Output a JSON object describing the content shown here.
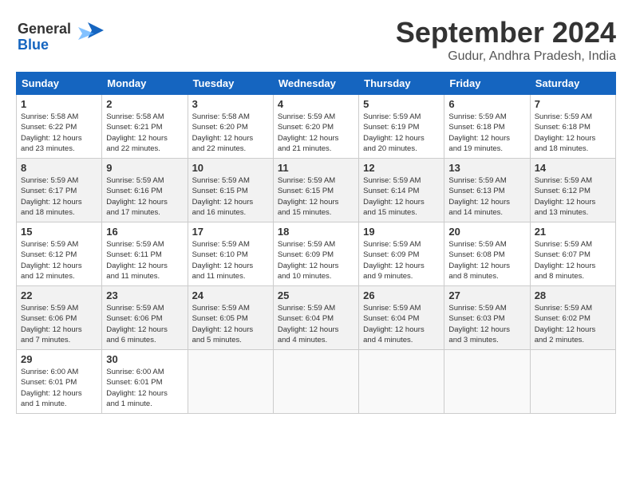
{
  "logo": {
    "line1": "General",
    "line2": "Blue"
  },
  "title": "September 2024",
  "location": "Gudur, Andhra Pradesh, India",
  "days_of_week": [
    "Sunday",
    "Monday",
    "Tuesday",
    "Wednesday",
    "Thursday",
    "Friday",
    "Saturday"
  ],
  "weeks": [
    [
      {
        "day": 1,
        "sunrise": "5:58 AM",
        "sunset": "6:22 PM",
        "daylight": "12 hours and 23 minutes."
      },
      {
        "day": 2,
        "sunrise": "5:58 AM",
        "sunset": "6:21 PM",
        "daylight": "12 hours and 22 minutes."
      },
      {
        "day": 3,
        "sunrise": "5:58 AM",
        "sunset": "6:20 PM",
        "daylight": "12 hours and 22 minutes."
      },
      {
        "day": 4,
        "sunrise": "5:59 AM",
        "sunset": "6:20 PM",
        "daylight": "12 hours and 21 minutes."
      },
      {
        "day": 5,
        "sunrise": "5:59 AM",
        "sunset": "6:19 PM",
        "daylight": "12 hours and 20 minutes."
      },
      {
        "day": 6,
        "sunrise": "5:59 AM",
        "sunset": "6:18 PM",
        "daylight": "12 hours and 19 minutes."
      },
      {
        "day": 7,
        "sunrise": "5:59 AM",
        "sunset": "6:18 PM",
        "daylight": "12 hours and 18 minutes."
      }
    ],
    [
      {
        "day": 8,
        "sunrise": "5:59 AM",
        "sunset": "6:17 PM",
        "daylight": "12 hours and 18 minutes."
      },
      {
        "day": 9,
        "sunrise": "5:59 AM",
        "sunset": "6:16 PM",
        "daylight": "12 hours and 17 minutes."
      },
      {
        "day": 10,
        "sunrise": "5:59 AM",
        "sunset": "6:15 PM",
        "daylight": "12 hours and 16 minutes."
      },
      {
        "day": 11,
        "sunrise": "5:59 AM",
        "sunset": "6:15 PM",
        "daylight": "12 hours and 15 minutes."
      },
      {
        "day": 12,
        "sunrise": "5:59 AM",
        "sunset": "6:14 PM",
        "daylight": "12 hours and 15 minutes."
      },
      {
        "day": 13,
        "sunrise": "5:59 AM",
        "sunset": "6:13 PM",
        "daylight": "12 hours and 14 minutes."
      },
      {
        "day": 14,
        "sunrise": "5:59 AM",
        "sunset": "6:12 PM",
        "daylight": "12 hours and 13 minutes."
      }
    ],
    [
      {
        "day": 15,
        "sunrise": "5:59 AM",
        "sunset": "6:12 PM",
        "daylight": "12 hours and 12 minutes."
      },
      {
        "day": 16,
        "sunrise": "5:59 AM",
        "sunset": "6:11 PM",
        "daylight": "12 hours and 11 minutes."
      },
      {
        "day": 17,
        "sunrise": "5:59 AM",
        "sunset": "6:10 PM",
        "daylight": "12 hours and 11 minutes."
      },
      {
        "day": 18,
        "sunrise": "5:59 AM",
        "sunset": "6:09 PM",
        "daylight": "12 hours and 10 minutes."
      },
      {
        "day": 19,
        "sunrise": "5:59 AM",
        "sunset": "6:09 PM",
        "daylight": "12 hours and 9 minutes."
      },
      {
        "day": 20,
        "sunrise": "5:59 AM",
        "sunset": "6:08 PM",
        "daylight": "12 hours and 8 minutes."
      },
      {
        "day": 21,
        "sunrise": "5:59 AM",
        "sunset": "6:07 PM",
        "daylight": "12 hours and 8 minutes."
      }
    ],
    [
      {
        "day": 22,
        "sunrise": "5:59 AM",
        "sunset": "6:06 PM",
        "daylight": "12 hours and 7 minutes."
      },
      {
        "day": 23,
        "sunrise": "5:59 AM",
        "sunset": "6:06 PM",
        "daylight": "12 hours and 6 minutes."
      },
      {
        "day": 24,
        "sunrise": "5:59 AM",
        "sunset": "6:05 PM",
        "daylight": "12 hours and 5 minutes."
      },
      {
        "day": 25,
        "sunrise": "5:59 AM",
        "sunset": "6:04 PM",
        "daylight": "12 hours and 4 minutes."
      },
      {
        "day": 26,
        "sunrise": "5:59 AM",
        "sunset": "6:04 PM",
        "daylight": "12 hours and 4 minutes."
      },
      {
        "day": 27,
        "sunrise": "5:59 AM",
        "sunset": "6:03 PM",
        "daylight": "12 hours and 3 minutes."
      },
      {
        "day": 28,
        "sunrise": "5:59 AM",
        "sunset": "6:02 PM",
        "daylight": "12 hours and 2 minutes."
      }
    ],
    [
      {
        "day": 29,
        "sunrise": "6:00 AM",
        "sunset": "6:01 PM",
        "daylight": "12 hours and 1 minute."
      },
      {
        "day": 30,
        "sunrise": "6:00 AM",
        "sunset": "6:01 PM",
        "daylight": "12 hours and 1 minute."
      },
      null,
      null,
      null,
      null,
      null
    ]
  ],
  "labels": {
    "sunrise": "Sunrise:",
    "sunset": "Sunset:",
    "daylight": "Daylight:"
  }
}
